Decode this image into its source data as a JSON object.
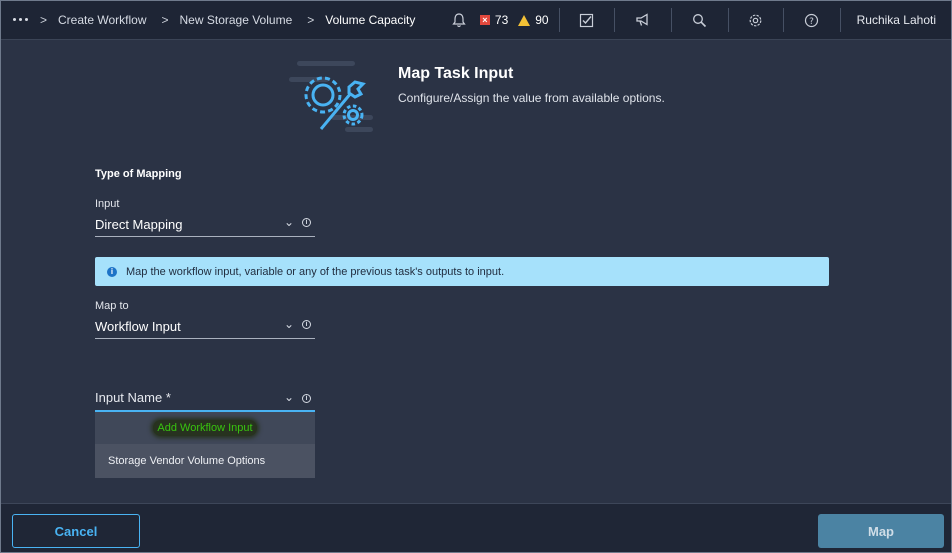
{
  "breadcrumb": {
    "items": [
      "Create Workflow",
      "New Storage Volume",
      "Volume Capacity"
    ]
  },
  "topbar": {
    "critical_count": "73",
    "warning_count": "90",
    "user_name": "Ruchika Lahoti",
    "icons": [
      "bell-icon",
      "alarm-critical-icon",
      "alarm-warning-icon",
      "tasks-icon",
      "announcement-icon",
      "search-icon",
      "settings-icon",
      "help-icon"
    ]
  },
  "header": {
    "title": "Map Task Input",
    "subtitle": "Configure/Assign the value from available options."
  },
  "form": {
    "type_of_mapping_label": "Type of Mapping",
    "input_label": "Input",
    "input_value": "Direct Mapping",
    "info_banner": "Map the workflow input, variable or any of the previous task's outputs to input.",
    "map_to_label": "Map to",
    "map_to_value": "Workflow Input",
    "input_name_label": "Input Name *",
    "dropdown_options": [
      "Add Workflow Input",
      "Storage Vendor Volume Options"
    ]
  },
  "footer": {
    "cancel_label": "Cancel",
    "map_label": "Map"
  },
  "colors": {
    "accent": "#49b3f3",
    "banner_bg": "#a6e1fb",
    "critical": "#e2483d",
    "warning": "#f3c136",
    "add_input_green": "#38c40f"
  }
}
